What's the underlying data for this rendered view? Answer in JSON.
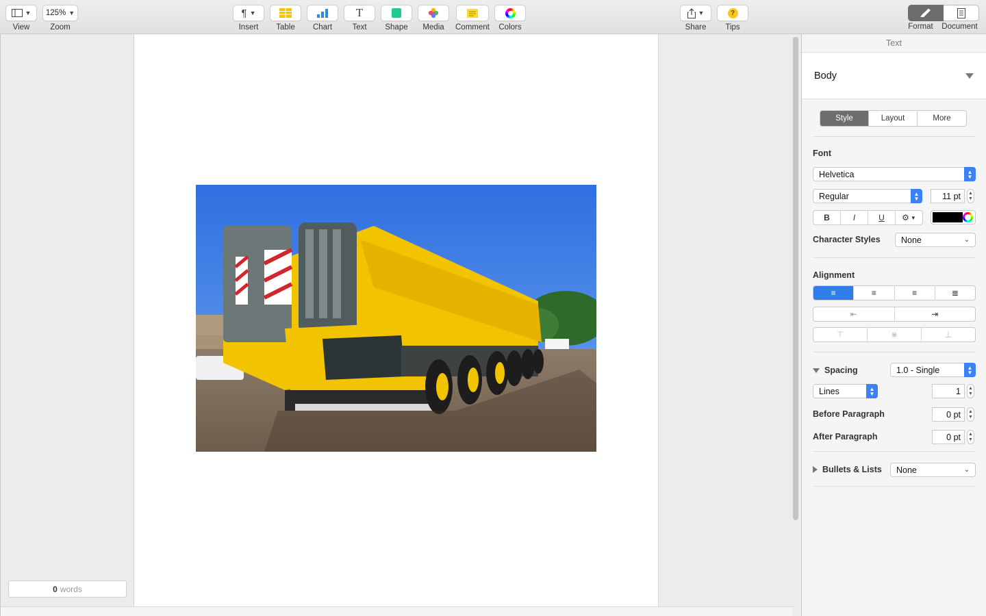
{
  "toolbar": {
    "view": "View",
    "zoom_value": "125%",
    "zoom": "Zoom",
    "insert": "Insert",
    "table": "Table",
    "chart": "Chart",
    "text": "Text",
    "shape": "Shape",
    "media": "Media",
    "comment": "Comment",
    "colors": "Colors",
    "share": "Share",
    "tips": "Tips",
    "format": "Format",
    "document": "Document"
  },
  "canvas": {
    "word_count": "0",
    "word_label": "words"
  },
  "inspector": {
    "title": "Text",
    "paragraph_style": "Body",
    "tabs": [
      "Style",
      "Layout",
      "More"
    ],
    "font_label": "Font",
    "font_family": "Helvetica",
    "font_typeface": "Regular",
    "font_size": "11 pt",
    "bold": "B",
    "italic": "I",
    "underline": "U",
    "text_color": "#000000",
    "character_styles_label": "Character Styles",
    "character_styles_value": "None",
    "alignment_label": "Alignment",
    "spacing_label": "Spacing",
    "spacing_value": "1.0 - Single",
    "lines_value": "Lines",
    "lines_number": "1",
    "before_paragraph_label": "Before Paragraph",
    "before_paragraph_value": "0 pt",
    "after_paragraph_label": "After Paragraph",
    "after_paragraph_value": "0 pt",
    "bullets_label": "Bullets & Lists",
    "bullets_value": "None"
  },
  "colors": {
    "accent": "#2f7de8",
    "crane_yellow": "#f2c400",
    "sky_blue": "#3a7fe8"
  }
}
